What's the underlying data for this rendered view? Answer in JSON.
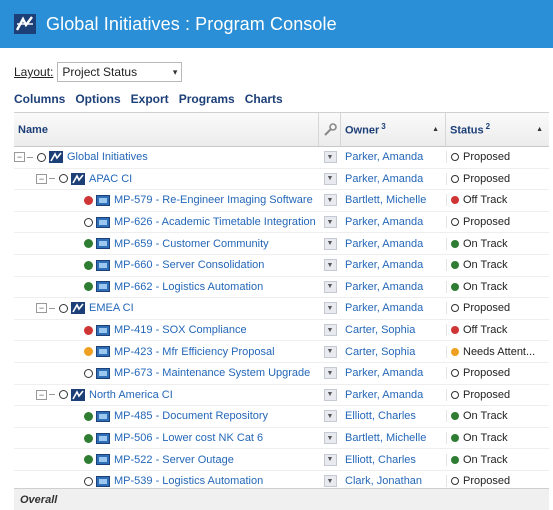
{
  "header": {
    "title": "Global Initiatives : Program Console",
    "icon": "program-logo-icon"
  },
  "layout": {
    "label": "Layout:",
    "value": "Project Status"
  },
  "menu": [
    "Columns",
    "Options",
    "Export",
    "Programs",
    "Charts"
  ],
  "columns": {
    "name": "Name",
    "owner": "Owner",
    "owner_sort": "3",
    "status": "Status",
    "status_sort": "2"
  },
  "colors": {
    "header_bg": "#2a8fd6",
    "on_track": "#2f7d32",
    "off_track": "#d03535",
    "needs_attention": "#f0a020"
  },
  "rows": [
    {
      "level": 0,
      "toggle": "⊟",
      "kind": "program",
      "health": "open",
      "name": "Global Initiatives",
      "owner": "Parker, Amanda",
      "status": "Proposed",
      "status_kind": "open"
    },
    {
      "level": 1,
      "toggle": "⊟",
      "kind": "program",
      "health": "open",
      "name": "APAC CI",
      "owner": "Parker, Amanda",
      "status": "Proposed",
      "status_kind": "open"
    },
    {
      "level": 2,
      "toggle": "",
      "kind": "project",
      "health": "red",
      "name": "MP-579 - Re-Engineer Imaging Software",
      "owner": "Bartlett, Michelle",
      "status": "Off Track",
      "status_kind": "red"
    },
    {
      "level": 2,
      "toggle": "",
      "kind": "project",
      "health": "open",
      "name": "MP-626 - Academic Timetable Integration",
      "owner": "Parker, Amanda",
      "status": "Proposed",
      "status_kind": "open"
    },
    {
      "level": 2,
      "toggle": "",
      "kind": "project",
      "health": "green",
      "name": "MP-659 - Customer Community",
      "owner": "Parker, Amanda",
      "status": "On Track",
      "status_kind": "green"
    },
    {
      "level": 2,
      "toggle": "",
      "kind": "project",
      "health": "green",
      "name": "MP-660 - Server Consolidation",
      "owner": "Parker, Amanda",
      "status": "On Track",
      "status_kind": "green"
    },
    {
      "level": 2,
      "toggle": "",
      "kind": "project",
      "health": "green",
      "name": "MP-662 - Logistics Automation",
      "owner": "Parker, Amanda",
      "status": "On Track",
      "status_kind": "green"
    },
    {
      "level": 1,
      "toggle": "⊟",
      "kind": "program",
      "health": "open",
      "name": "EMEA CI",
      "owner": "Parker, Amanda",
      "status": "Proposed",
      "status_kind": "open"
    },
    {
      "level": 2,
      "toggle": "",
      "kind": "project",
      "health": "red",
      "name": "MP-419 - SOX Compliance",
      "owner": "Carter, Sophia",
      "status": "Off Track",
      "status_kind": "red"
    },
    {
      "level": 2,
      "toggle": "",
      "kind": "project",
      "health": "orange",
      "name": "MP-423 - Mfr Efficiency Proposal",
      "owner": "Carter, Sophia",
      "status": "Needs Attent...",
      "status_kind": "orange"
    },
    {
      "level": 2,
      "toggle": "",
      "kind": "project",
      "health": "open",
      "name": "MP-673 - Maintenance System Upgrade",
      "owner": "Parker, Amanda",
      "status": "Proposed",
      "status_kind": "open"
    },
    {
      "level": 1,
      "toggle": "⊟",
      "kind": "program",
      "health": "open",
      "name": "North America CI",
      "owner": "Parker, Amanda",
      "status": "Proposed",
      "status_kind": "open"
    },
    {
      "level": 2,
      "toggle": "",
      "kind": "project",
      "health": "green",
      "name": "MP-485 - Document Repository",
      "owner": "Elliott, Charles",
      "status": "On Track",
      "status_kind": "green"
    },
    {
      "level": 2,
      "toggle": "",
      "kind": "project",
      "health": "green",
      "name": "MP-506 - Lower cost NK Cat 6",
      "owner": "Bartlett, Michelle",
      "status": "On Track",
      "status_kind": "green"
    },
    {
      "level": 2,
      "toggle": "",
      "kind": "project",
      "health": "green",
      "name": "MP-522 - Server Outage",
      "owner": "Elliott, Charles",
      "status": "On Track",
      "status_kind": "green"
    },
    {
      "level": 2,
      "toggle": "",
      "kind": "project",
      "health": "open",
      "name": "MP-539 - Logistics Automation",
      "owner": "Clark, Jonathan",
      "status": "Proposed",
      "status_kind": "open"
    }
  ],
  "footer": {
    "label": "Overall"
  }
}
